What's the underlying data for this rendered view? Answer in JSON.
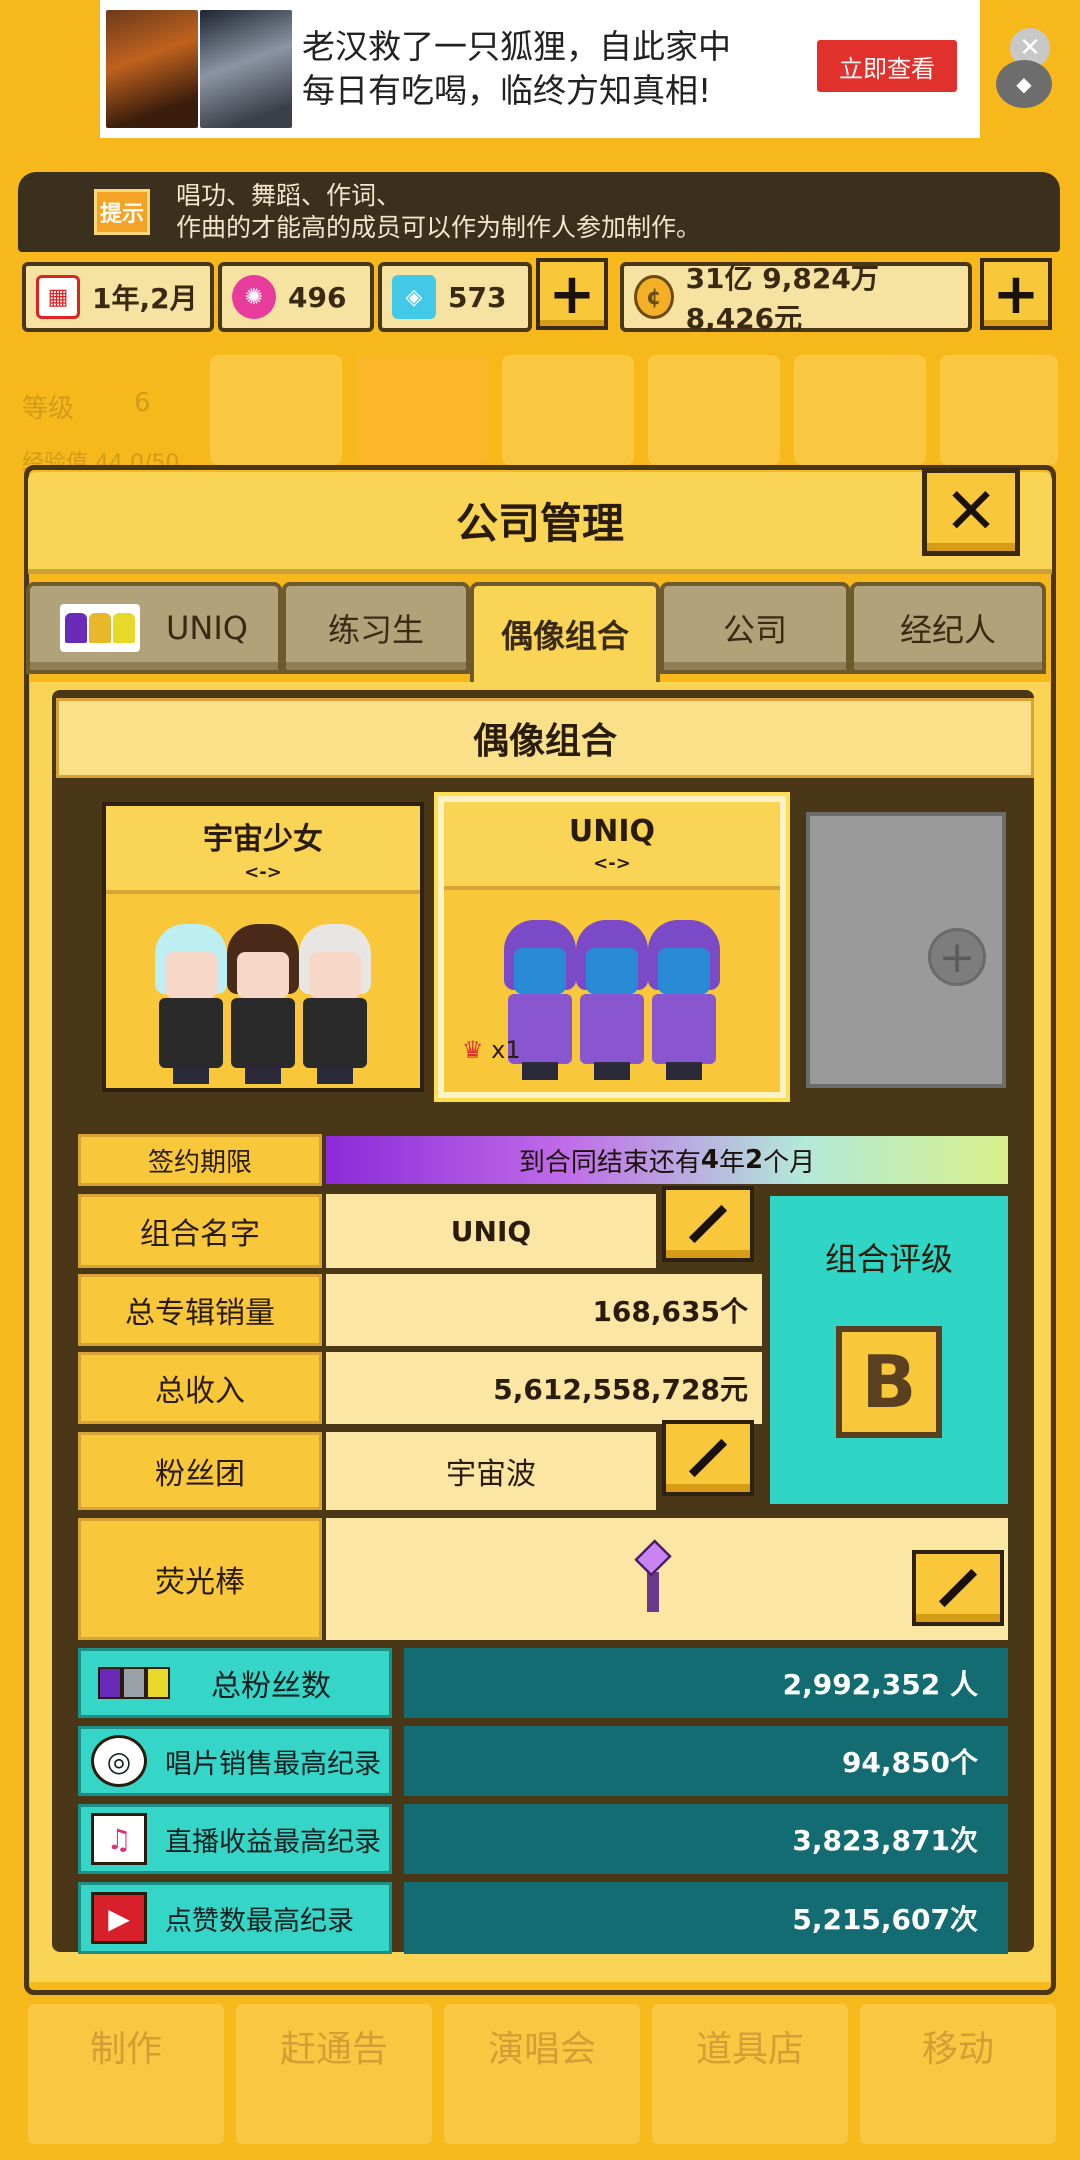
{
  "ad": {
    "text": "老汉救了一只狐狸，自此家中每日有吃喝，临终方知真相!",
    "cta": "立即查看",
    "close_icon": "close-icon"
  },
  "hint": {
    "badge": "提示",
    "text_line1": "唱功、舞蹈、作词、",
    "text_line2": "作曲的才能高的成员可以作为制作人参加制作。"
  },
  "resources": {
    "date": "1年,2月",
    "pink_gems": "496",
    "blue_gems": "573",
    "money": "31亿 9,824万 8,426元"
  },
  "background": {
    "level_label": "等级",
    "level_value": "6",
    "exp_label": "经验值 44.0/50"
  },
  "window": {
    "title": "公司管理"
  },
  "tabs": [
    {
      "label": "UNIQ"
    },
    {
      "label": "练习生"
    },
    {
      "label": "偶像组合"
    },
    {
      "label": "公司"
    },
    {
      "label": "经纪人"
    }
  ],
  "section": {
    "title": "偶像组合"
  },
  "groups": [
    {
      "name": "宇宙少女",
      "arrows": "<->"
    },
    {
      "name": "UNIQ",
      "arrows": "<->",
      "badge": "x1"
    }
  ],
  "info": {
    "contract_label": "签约期限",
    "contract_prefix": "到合同结束还有",
    "contract_years": "4",
    "contract_year_unit": "年",
    "contract_months": "2",
    "contract_month_unit": "个月",
    "group_name_label": "组合名字",
    "group_name": "UNIQ",
    "album_sales_label": "总专辑销量",
    "album_sales": "168,635个",
    "income_label": "总收入",
    "income": "5,612,558,728元",
    "fanclub_label": "粉丝团",
    "fanclub": "宇宙波",
    "lightstick_label": "荧光棒",
    "rating_label": "组合评级",
    "rating_grade": "B"
  },
  "stats": [
    {
      "label": "总粉丝数",
      "value": "2,992,352 人"
    },
    {
      "label": "唱片销售最高纪录",
      "value": "94,850个"
    },
    {
      "label": "直播收益最高纪录",
      "value": "3,823,871次"
    },
    {
      "label": "点赞数最高纪录",
      "value": "5,215,607次"
    }
  ],
  "bottom_nav": [
    "制作",
    "赶通告",
    "演唱会",
    "道具店",
    "移动"
  ],
  "colors": {
    "background": "#f7b81b",
    "panel_header": "#fad555",
    "teal": "#35d5c8",
    "dark_teal": "#136c72",
    "purple": "#8b2bd9"
  }
}
